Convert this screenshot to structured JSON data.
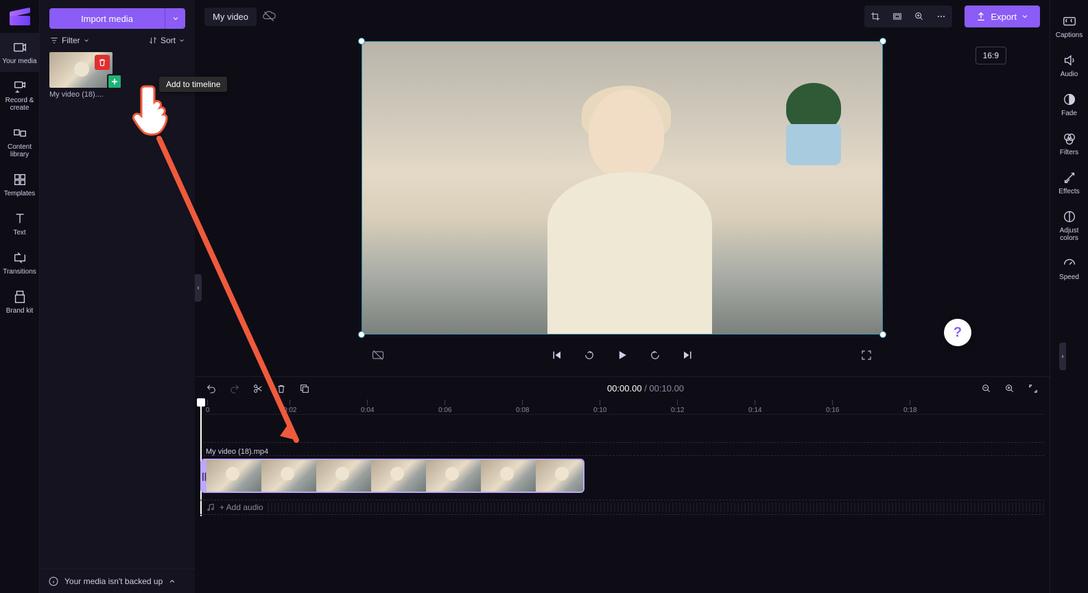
{
  "header": {
    "title": "My video",
    "export_label": "Export",
    "aspect_ratio": "16:9"
  },
  "left_rail": [
    {
      "id": "your-media",
      "label": "Your media"
    },
    {
      "id": "record-create",
      "label": "Record & create"
    },
    {
      "id": "content-library",
      "label": "Content library"
    },
    {
      "id": "templates",
      "label": "Templates"
    },
    {
      "id": "text",
      "label": "Text"
    },
    {
      "id": "transitions",
      "label": "Transitions"
    },
    {
      "id": "brand-kit",
      "label": "Brand kit"
    }
  ],
  "panel": {
    "import_label": "Import media",
    "filter_label": "Filter",
    "sort_label": "Sort",
    "tooltip": "Add to timeline",
    "media_item_label": "My video (18)....",
    "backup_message": "Your media isn't backed up"
  },
  "player": {
    "controls": {
      "closed_caption": "closed-caption",
      "prev": "previous",
      "back": "skip-back",
      "play": "play",
      "fwd": "skip-forward",
      "next": "next",
      "fullscreen": "fullscreen"
    }
  },
  "timeline": {
    "current_time": "00:00.00",
    "total_time": "00:10.00",
    "ticks": [
      "0",
      "0:02",
      "0:04",
      "0:06",
      "0:08",
      "0:10",
      "0:12",
      "0:14",
      "0:16",
      "0:18"
    ],
    "clip_label": "My video (18).mp4",
    "add_audio_label": "+ Add audio"
  },
  "right_rail": [
    {
      "id": "captions",
      "label": "Captions"
    },
    {
      "id": "audio",
      "label": "Audio"
    },
    {
      "id": "fade",
      "label": "Fade"
    },
    {
      "id": "filters",
      "label": "Filters"
    },
    {
      "id": "effects",
      "label": "Effects"
    },
    {
      "id": "adjust-colors",
      "label": "Adjust colors"
    },
    {
      "id": "speed",
      "label": "Speed"
    }
  ]
}
